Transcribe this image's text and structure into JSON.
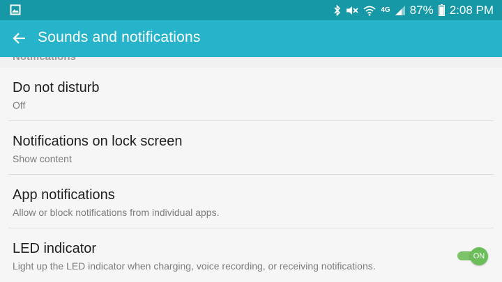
{
  "status_bar": {
    "battery": "87%",
    "time": "2:08 PM",
    "network_label": "4G",
    "icons": [
      "gallery-icon",
      "bluetooth-icon",
      "mute-icon",
      "wifi-icon",
      "signal-icon",
      "battery-icon"
    ]
  },
  "app_bar": {
    "title": "Sounds and notifications",
    "back_icon": "back-arrow-icon"
  },
  "section_header": "Notifications",
  "settings": [
    {
      "title": "Do not disturb",
      "summary": "Off"
    },
    {
      "title": "Notifications on lock screen",
      "summary": "Show content"
    },
    {
      "title": "App notifications",
      "summary": "Allow or block notifications from individual apps."
    },
    {
      "title": "LED indicator",
      "summary": "Light up the LED indicator when charging, voice recording, or receiving notifications.",
      "toggle": {
        "state": "ON",
        "on": true
      }
    }
  ],
  "colors": {
    "status_bar": "#1798a6",
    "app_bar": "#27b3c9",
    "toggle_on": "#6bbe5a",
    "background": "#f6f6f6"
  }
}
